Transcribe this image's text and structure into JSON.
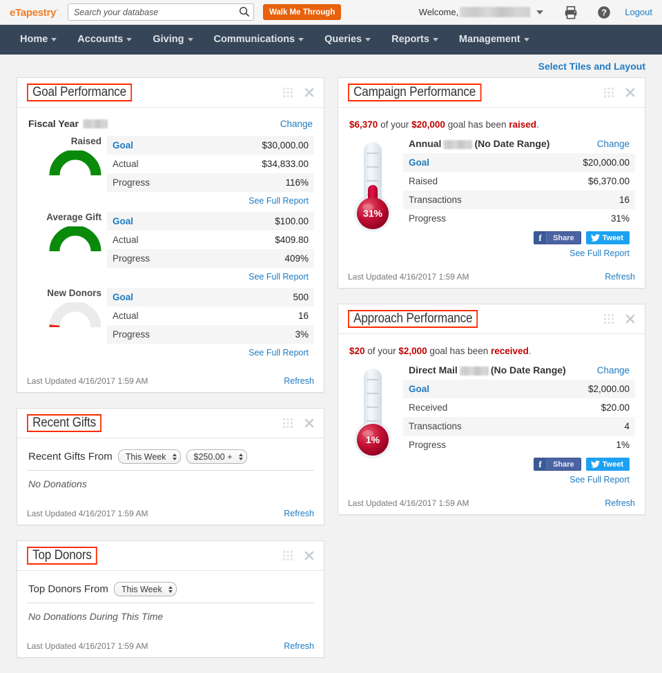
{
  "topbar": {
    "logo": "eTapestry",
    "logo_mark": "®",
    "search_placeholder": "Search your database",
    "search_value": "",
    "search_icon": "search-icon",
    "walk_me_through": "Walk Me Through",
    "welcome_label": "Welcome,",
    "welcome_user": "[redacted]",
    "print_icon": "printer-icon",
    "help_icon": "help-circle-icon",
    "logout": "Logout"
  },
  "nav": {
    "items": [
      {
        "label": "Home"
      },
      {
        "label": "Accounts"
      },
      {
        "label": "Giving"
      },
      {
        "label": "Communications"
      },
      {
        "label": "Queries"
      },
      {
        "label": "Reports"
      },
      {
        "label": "Management"
      }
    ]
  },
  "toolbar": {
    "select_tiles_and_layout": "Select Tiles and Layout"
  },
  "panels": {
    "goal_performance": {
      "title": "Goal Performance",
      "fiscal_year_label": "Fiscal Year",
      "fiscal_year_value": "[redacted]",
      "change_label": "Change",
      "see_full_report": "See Full Report",
      "last_updated": "Last Updated 4/16/2017 1:59 AM",
      "refresh": "Refresh",
      "metrics": [
        {
          "name": "Raised",
          "goal_label": "Goal",
          "goal_value": "$30,000.00",
          "actual_label": "Actual",
          "actual_value": "$34,833.00",
          "progress_label": "Progress",
          "progress_value": "116%",
          "progress_pct": 100,
          "gauge_color": "#0a8a0a"
        },
        {
          "name": "Average Gift",
          "goal_label": "Goal",
          "goal_value": "$100.00",
          "actual_label": "Actual",
          "actual_value": "$409.80",
          "progress_label": "Progress",
          "progress_value": "409%",
          "progress_pct": 100,
          "gauge_color": "#0a8a0a"
        },
        {
          "name": "New Donors",
          "goal_label": "Goal",
          "goal_value": "500",
          "actual_label": "Actual",
          "actual_value": "16",
          "progress_label": "Progress",
          "progress_value": "3%",
          "progress_pct": 3,
          "gauge_color": "#e8261c"
        }
      ]
    },
    "campaign_performance": {
      "title": "Campaign Performance",
      "summary": {
        "amount": "$6,370",
        "mid": "of your",
        "goal": "$20,000",
        "tail": "goal has been",
        "verb": "raised",
        "period": "."
      },
      "campaign_name_prefix": "Annual",
      "campaign_name_redacted": "[redacted]",
      "campaign_name_suffix": "(No Date Range)",
      "change_label": "Change",
      "rows": [
        {
          "label": "Goal",
          "value": "$20,000.00",
          "link": true
        },
        {
          "label": "Raised",
          "value": "$6,370.00",
          "link": false
        },
        {
          "label": "Transactions",
          "value": "16",
          "link": false
        },
        {
          "label": "Progress",
          "value": "31%",
          "link": false
        }
      ],
      "thermometer_pct": 31,
      "thermometer_label": "31%",
      "share_label": "Share",
      "tweet_label": "Tweet",
      "see_full_report": "See Full Report",
      "last_updated": "Last Updated 4/16/2017 1:59 AM",
      "refresh": "Refresh"
    },
    "approach_performance": {
      "title": "Approach Performance",
      "summary": {
        "amount": "$20",
        "mid": "of your",
        "goal": "$2,000",
        "tail": "goal has been",
        "verb": "received",
        "period": "."
      },
      "campaign_name_prefix": "Direct Mail",
      "campaign_name_redacted": "[redacted]",
      "campaign_name_suffix": "(No Date Range)",
      "change_label": "Change",
      "rows": [
        {
          "label": "Goal",
          "value": "$2,000.00",
          "link": true
        },
        {
          "label": "Received",
          "value": "$20.00",
          "link": false
        },
        {
          "label": "Transactions",
          "value": "4",
          "link": false
        },
        {
          "label": "Progress",
          "value": "1%",
          "link": false
        }
      ],
      "thermometer_pct": 1,
      "thermometer_label": "1%",
      "share_label": "Share",
      "tweet_label": "Tweet",
      "see_full_report": "See Full Report",
      "last_updated": "Last Updated 4/16/2017 1:59 AM",
      "refresh": "Refresh"
    },
    "recent_gifts": {
      "title": "Recent Gifts",
      "filter_label": "Recent Gifts From",
      "period_select": "This Week",
      "amount_select": "$250.00 +",
      "empty_message": "No Donations",
      "last_updated": "Last Updated 4/16/2017 1:59 AM",
      "refresh": "Refresh"
    },
    "top_donors": {
      "title": "Top Donors",
      "filter_label": "Top Donors From",
      "period_select": "This Week",
      "empty_message": "No Donations During This Time",
      "last_updated": "Last Updated 4/16/2017 1:59 AM",
      "refresh": "Refresh"
    }
  },
  "colors": {
    "brand_orange": "#f07d25",
    "cta_orange": "#e8610c",
    "nav_dark": "#374558",
    "link_blue": "#1f7bc2",
    "gauge_green": "#0a8a0a",
    "gauge_red": "#e8261c",
    "alert_red": "#c00000",
    "highlight_box": "#ff2a00",
    "facebook_blue": "#3b5998",
    "twitter_blue": "#1da1f2"
  }
}
